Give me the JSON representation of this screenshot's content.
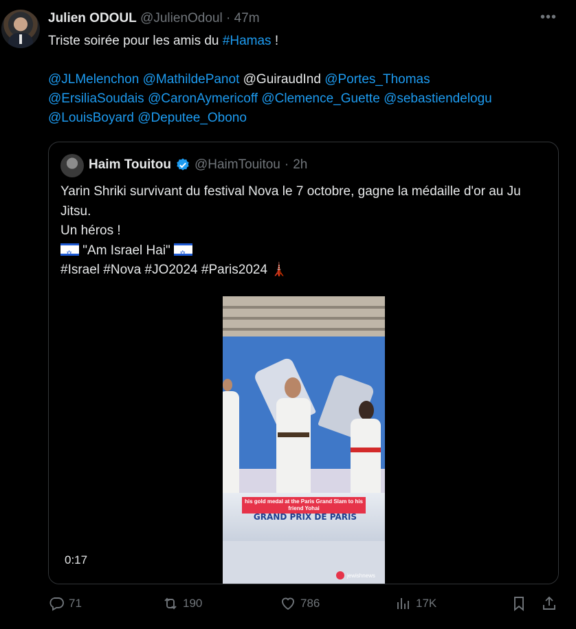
{
  "tweet": {
    "author_name": "Julien ODOUL",
    "handle": "@JulienOdoul",
    "separator": "·",
    "time": "47m",
    "more": "•••",
    "text_before": "Triste soirée pour les amis du ",
    "hashtag": "#Hamas",
    "text_after": " !",
    "mentions": [
      [
        "@JLMelenchon",
        "@MathildePanot"
      ],
      [
        "@Portes_Thomas"
      ],
      [
        "@ErsiliaSoudais",
        "@CaronAymericoff",
        "@Clemence_Guette",
        "@sebastiendelogu"
      ],
      [
        "@LouisBoyard",
        "@Deputee_Obono"
      ]
    ],
    "plain_mention": "@GuiraudInd"
  },
  "quote": {
    "author_name": "Haim Touitou",
    "handle": "@HaimTouitou",
    "separator": "·",
    "time": "2h",
    "line1": "Yarin Shriki  survivant du festival Nova le 7 octobre, gagne la médaille d'or au Ju Jitsu.",
    "line2": "Un héros !",
    "line3": "\"Am Israel Hai\"",
    "line4": "#Israel #Nova #JO2024 #Paris2024",
    "eiffel": "🗼",
    "video": {
      "caption": "his gold medal at the Paris Grand Slam to his friend Yohai",
      "banner": "GRAND PRIX DE PARIS",
      "watermark": "jewishnews",
      "duration": "0:17"
    }
  },
  "actions": {
    "replies": "71",
    "reposts": "190",
    "likes": "786",
    "views": "17K"
  },
  "colors": {
    "link": "#1d9bf0",
    "muted": "#71767b",
    "text": "#e7e9ea",
    "verified": "#1d9bf0"
  }
}
